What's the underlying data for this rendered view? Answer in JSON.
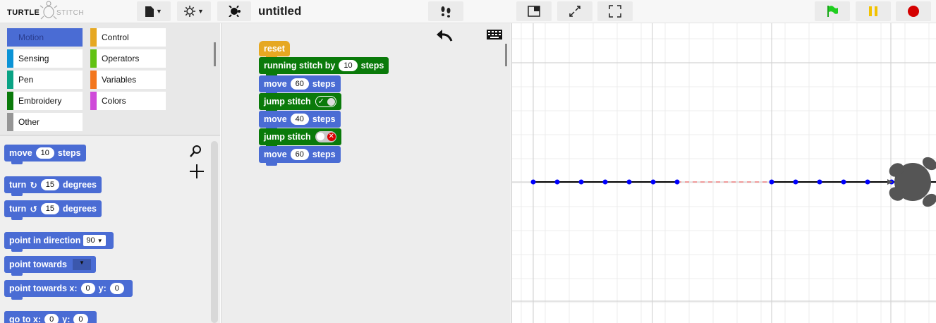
{
  "app": {
    "logo_left": "TURTLE",
    "logo_right": "STITCH",
    "project_name": "untitled"
  },
  "icons": {
    "file": "file-icon",
    "settings": "gear-icon",
    "turtle": "turtle-icon",
    "footprints": "footprints-icon",
    "stage_normal": "stage-size-icon",
    "stage_shrink": "shrink-icon",
    "fullscreen": "fullscreen-icon",
    "green_flag": "green-flag-icon",
    "pause": "pause-icon",
    "stop": "stop-icon",
    "undo": "undo-icon",
    "keyboard": "keyboard-icon",
    "search": "search-icon",
    "add": "plus-icon"
  },
  "categories": [
    {
      "label": "Motion",
      "color": "#4a6cd4"
    },
    {
      "label": "Control",
      "color": "#e6a822"
    },
    {
      "label": "Sensing",
      "color": "#0b93d6"
    },
    {
      "label": "Operators",
      "color": "#62c213"
    },
    {
      "label": "Pen",
      "color": "#0aa384"
    },
    {
      "label": "Variables",
      "color": "#f3761d"
    },
    {
      "label": "Embroidery",
      "color": "#0a7a0a"
    },
    {
      "label": "Colors",
      "color": "#cf4ad9"
    },
    {
      "label": "Other",
      "color": "#969696"
    }
  ],
  "palette": {
    "move": {
      "label": "move",
      "value": "10",
      "unit": "steps"
    },
    "turn_cw": {
      "label": "turn",
      "value": "15",
      "unit": "degrees"
    },
    "turn_ccw": {
      "label": "turn",
      "value": "15",
      "unit": "degrees"
    },
    "point_dir": {
      "label": "point in direction",
      "value": "90"
    },
    "point_towards": {
      "label": "point towards"
    },
    "point_towards_xy": {
      "label": "point towards x:",
      "x": "0",
      "ylabel": "y:",
      "y": "0"
    },
    "go_to_xy": {
      "label": "go to x:",
      "x": "0",
      "ylabel": "y:",
      "y": "0"
    }
  },
  "script": {
    "reset": "reset",
    "running_stitch": {
      "label": "running stitch by",
      "value": "10",
      "unit": "steps"
    },
    "move1": {
      "label": "move",
      "value": "60",
      "unit": "steps"
    },
    "jump_on": {
      "label": "jump stitch"
    },
    "move2": {
      "label": "move",
      "value": "40",
      "unit": "steps"
    },
    "jump_off": {
      "label": "jump stitch"
    },
    "move3": {
      "label": "move",
      "value": "60",
      "unit": "steps"
    }
  },
  "stage": {
    "stitch_color": "#000000",
    "point_color": "#0000ff",
    "jump_color": "#f08080",
    "turtle_color": "#555555"
  }
}
